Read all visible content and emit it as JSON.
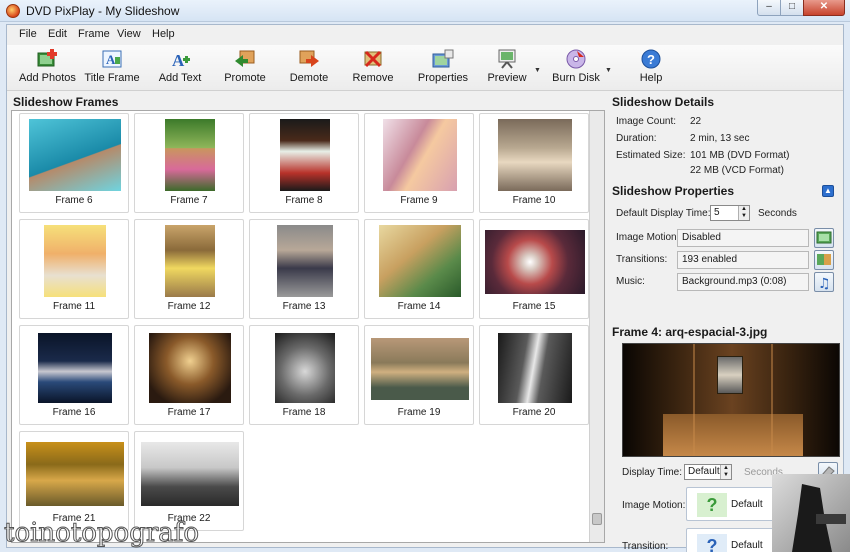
{
  "window": {
    "title": "DVD PixPlay - My Slideshow",
    "min": "–",
    "max": "□",
    "close": "✕"
  },
  "menu": [
    "File",
    "Edit",
    "Frame",
    "View",
    "Help"
  ],
  "toolbar": [
    {
      "label": "Add Photos",
      "icon": "add-photos-icon"
    },
    {
      "label": "Title Frame",
      "icon": "title-frame-icon"
    },
    {
      "label": "Add Text",
      "icon": "add-text-icon"
    },
    {
      "label": "Promote",
      "icon": "promote-icon"
    },
    {
      "label": "Demote",
      "icon": "demote-icon"
    },
    {
      "label": "Remove",
      "icon": "remove-icon"
    },
    {
      "label": "Properties",
      "icon": "properties-icon"
    },
    {
      "label": "Preview",
      "icon": "preview-icon"
    },
    {
      "label": "Burn Disk",
      "icon": "burn-disk-icon"
    },
    {
      "label": "Help",
      "icon": "help-icon"
    }
  ],
  "frames_title": "Slideshow Frames",
  "frames": [
    "Frame 6",
    "Frame 7",
    "Frame 8",
    "Frame 9",
    "Frame 10",
    "Frame 11",
    "Frame 12",
    "Frame 13",
    "Frame 14",
    "Frame 15",
    "Frame 16",
    "Frame 17",
    "Frame 18",
    "Frame 19",
    "Frame 20",
    "Frame 21",
    "Frame 22"
  ],
  "details": {
    "title": "Slideshow Details",
    "image_count_label": "Image Count:",
    "image_count": "22",
    "duration_label": "Duration:",
    "duration": "2 min, 13 sec",
    "size_label": "Estimated Size:",
    "size_dvd": "101 MB (DVD Format)",
    "size_vcd": "22 MB (VCD Format)"
  },
  "properties": {
    "title": "Slideshow Properties",
    "display_time_label": "Default Display Time:",
    "display_time": "5",
    "seconds": "Seconds",
    "motion_label": "Image Motion:",
    "motion": "Disabled",
    "transitions_label": "Transitions:",
    "transitions": "193 enabled",
    "music_label": "Music:",
    "music": "Background.mp3 (0:08)"
  },
  "frame": {
    "title": "Frame 4: arq-espacial-3.jpg",
    "display_time_label": "Display Time:",
    "display_time": "Default",
    "seconds": "Seconds",
    "motion_label": "Image Motion:",
    "motion": "Default",
    "transition_label": "Transition:",
    "transition": "Default"
  },
  "watermark": "toinotopografo",
  "colors": {
    "accent": "#2d6fce",
    "title_bar": "#d6e4f4"
  }
}
